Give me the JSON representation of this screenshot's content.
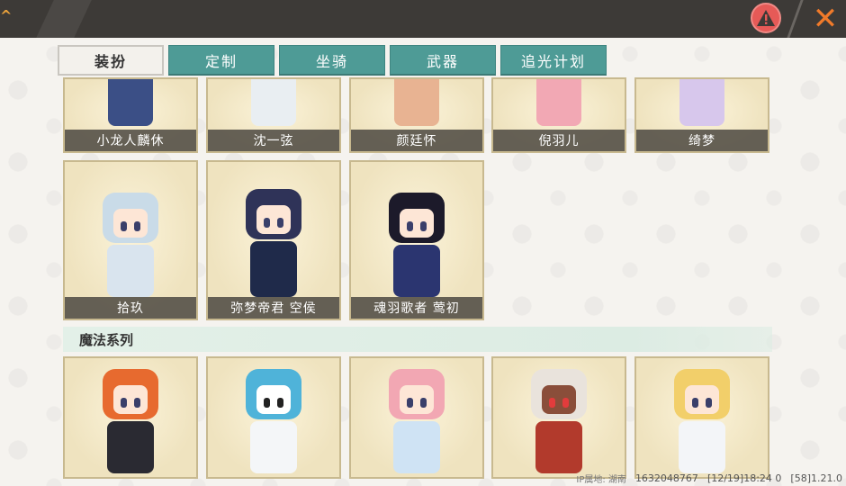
{
  "colors": {
    "topbar": "#3d3a37",
    "tab_active_bg": "#f3f1ec",
    "tab_bg": "#4e9b96",
    "card_bg": "#efe3bf",
    "warning": "#e65a57",
    "close": "#f07a2a"
  },
  "topbar": {
    "corner_mark": "^",
    "warning_icon": "warning-icon",
    "close_icon": "close-icon"
  },
  "tabs": [
    {
      "label": "装扮",
      "active": true
    },
    {
      "label": "定制",
      "active": false
    },
    {
      "label": "坐骑",
      "active": false
    },
    {
      "label": "武器",
      "active": false
    },
    {
      "label": "追光计划",
      "active": false
    }
  ],
  "outfits_row1": [
    {
      "name": "小龙人麟休"
    },
    {
      "name": "沈一弦"
    },
    {
      "name": "颜廷怀"
    },
    {
      "name": "倪羽儿"
    },
    {
      "name": "绮梦"
    }
  ],
  "outfits_row2": [
    {
      "name": "拾玖"
    },
    {
      "name": "弥梦帝君 空侯"
    },
    {
      "name": "魂羽歌者 莺初"
    }
  ],
  "section": {
    "title": "魔法系列"
  },
  "magic_series": [
    {
      "name": ""
    },
    {
      "name": ""
    },
    {
      "name": ""
    },
    {
      "name": ""
    },
    {
      "name": ""
    }
  ],
  "status": {
    "ip": "IP属地: 湖南",
    "uid": "1632048767",
    "time": "[12/19]18:24 0",
    "version": "[58]1.21.0"
  }
}
